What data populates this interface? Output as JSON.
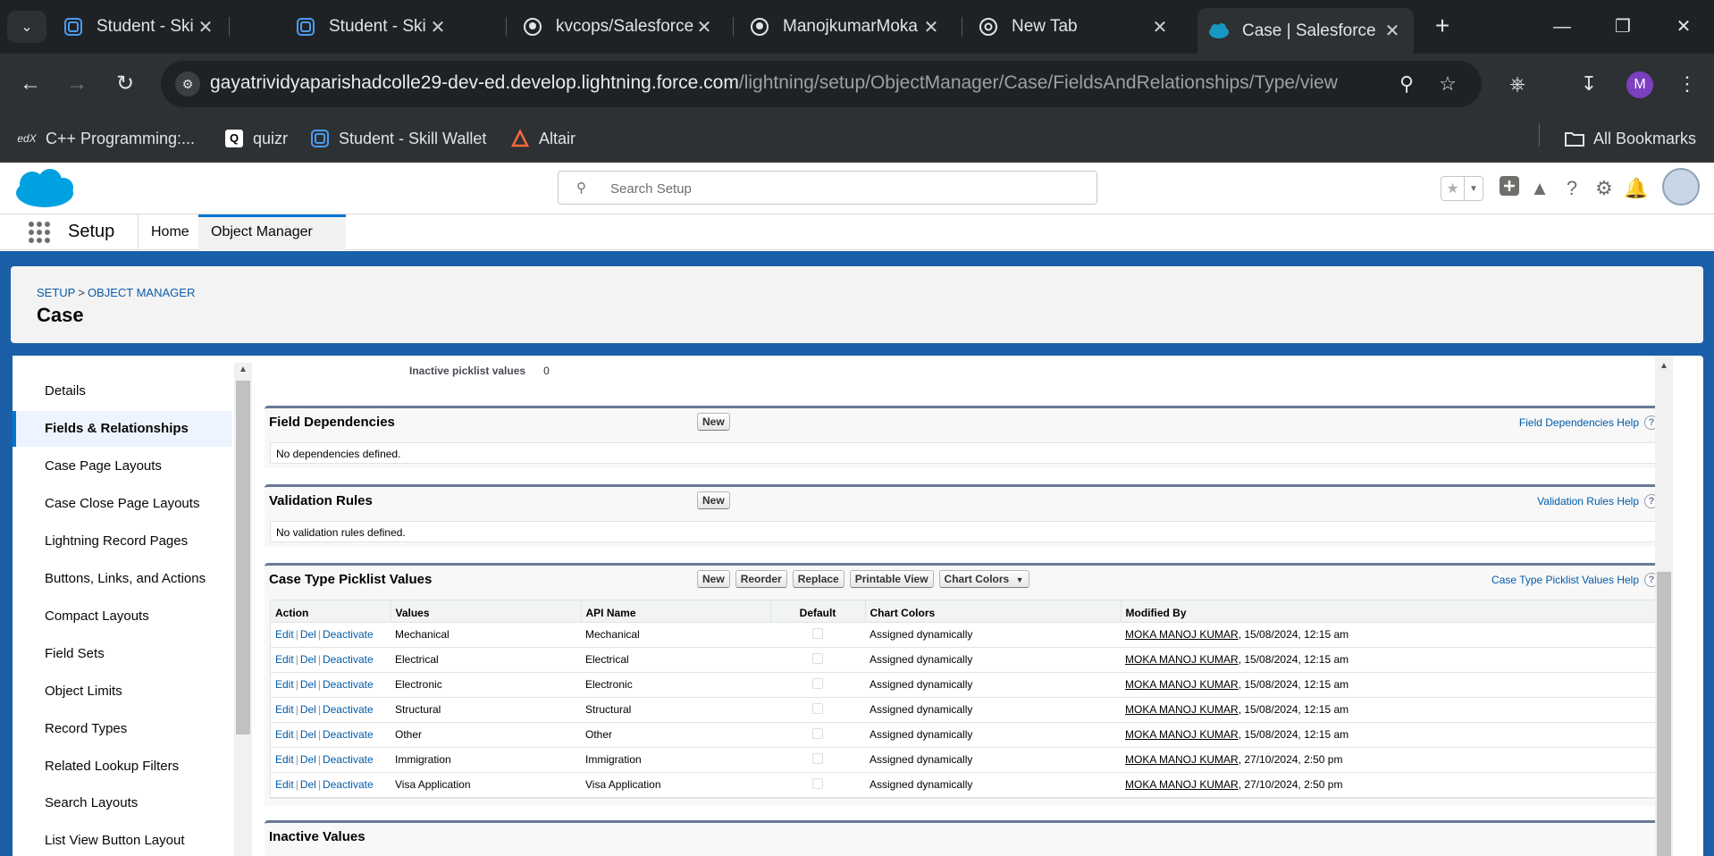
{
  "browser": {
    "tabs": [
      {
        "title": "Student - Skill Wall",
        "icon": "skill-wallet-icon",
        "active": false
      },
      {
        "title": "Student - Skill Wall",
        "icon": "skill-wallet-icon",
        "active": false
      },
      {
        "title": "kvcops/Salesforce",
        "icon": "github-icon",
        "active": false
      },
      {
        "title": "ManojkumarMoka",
        "icon": "github-icon",
        "active": false
      },
      {
        "title": "New Tab",
        "icon": "chrome-icon",
        "active": false
      },
      {
        "title": "Case | Salesforce",
        "icon": "salesforce-cloud-icon",
        "active": true
      }
    ],
    "url_host": "gayatrividyaparishadcolle29-dev-ed.develop.lightning.force.com",
    "url_path": "/lightning/setup/ObjectManager/Case/FieldsAndRelationships/Type/view",
    "profile_initial": "M",
    "bookmarks": [
      {
        "label": "C++ Programming:...",
        "icon": "edx-icon"
      },
      {
        "label": "quizr",
        "icon": "quizr-icon"
      },
      {
        "label": "Student - Skill Wallet",
        "icon": "skill-wallet-icon"
      },
      {
        "label": "Altair",
        "icon": "altair-icon"
      }
    ],
    "all_bookmarks_label": "All Bookmarks"
  },
  "sf_header": {
    "search_placeholder": "Search Setup"
  },
  "sf_nav": {
    "app_name": "Setup",
    "home_label": "Home",
    "object_manager_label": "Object Manager"
  },
  "object_header": {
    "breadcrumb_setup": "SETUP",
    "breadcrumb_sep": ">",
    "breadcrumb_object_manager": "OBJECT MANAGER",
    "title": "Case"
  },
  "left_nav": {
    "items": [
      "Details",
      "Fields & Relationships",
      "Case Page Layouts",
      "Case Close Page Layouts",
      "Lightning Record Pages",
      "Buttons, Links, and Actions",
      "Compact Layouts",
      "Field Sets",
      "Object Limits",
      "Record Types",
      "Related Lookup Filters",
      "Search Layouts",
      "List View Button Layout"
    ],
    "active_index": 1
  },
  "main": {
    "inactive_picklist_label": "Inactive picklist values",
    "inactive_picklist_value": "0",
    "field_dependencies": {
      "title": "Field Dependencies",
      "new_label": "New",
      "help_label": "Field Dependencies Help",
      "empty_text": "No dependencies defined."
    },
    "validation_rules": {
      "title": "Validation Rules",
      "new_label": "New",
      "help_label": "Validation Rules Help",
      "empty_text": "No validation rules defined."
    },
    "picklist": {
      "title": "Case Type Picklist Values",
      "buttons": {
        "new": "New",
        "reorder": "Reorder",
        "replace": "Replace",
        "printable": "Printable View",
        "chart_colors": "Chart Colors"
      },
      "help_label": "Case Type Picklist Values Help",
      "columns": [
        "Action",
        "Values",
        "API Name",
        "Default",
        "Chart Colors",
        "Modified By"
      ],
      "action_labels": {
        "edit": "Edit",
        "del": "Del",
        "deactivate": "Deactivate",
        "sep": "|"
      },
      "rows": [
        {
          "value": "Mechanical",
          "api": "Mechanical",
          "color": "Assigned dynamically",
          "user": "MOKA MANOJ KUMAR",
          "date": ", 15/08/2024, 12:15 am"
        },
        {
          "value": "Electrical",
          "api": "Electrical",
          "color": "Assigned dynamically",
          "user": "MOKA MANOJ KUMAR",
          "date": ", 15/08/2024, 12:15 am"
        },
        {
          "value": "Electronic",
          "api": "Electronic",
          "color": "Assigned dynamically",
          "user": "MOKA MANOJ KUMAR",
          "date": ", 15/08/2024, 12:15 am"
        },
        {
          "value": "Structural",
          "api": "Structural",
          "color": "Assigned dynamically",
          "user": "MOKA MANOJ KUMAR",
          "date": ", 15/08/2024, 12:15 am"
        },
        {
          "value": "Other",
          "api": "Other",
          "color": "Assigned dynamically",
          "user": "MOKA MANOJ KUMAR",
          "date": ", 15/08/2024, 12:15 am"
        },
        {
          "value": "Immigration",
          "api": "Immigration",
          "color": "Assigned dynamically",
          "user": "MOKA MANOJ KUMAR",
          "date": ", 27/10/2024, 2:50 pm"
        },
        {
          "value": "Visa Application",
          "api": "Visa Application",
          "color": "Assigned dynamically",
          "user": "MOKA MANOJ KUMAR",
          "date": ", 27/10/2024, 2:50 pm"
        }
      ]
    },
    "inactive_values": {
      "title": "Inactive Values"
    }
  },
  "colors": {
    "chrome_dark": "#1f2225",
    "chrome_toolbar": "#2d3134",
    "sf_blue": "#0176d3",
    "page_bg": "#1b5fa9",
    "link": "#015ba7"
  }
}
